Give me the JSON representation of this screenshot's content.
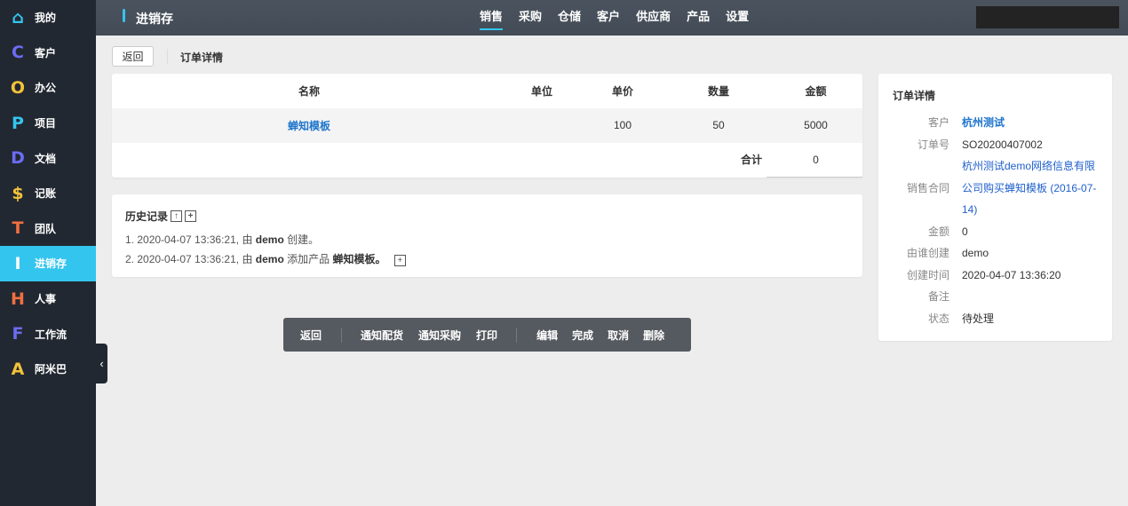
{
  "sidebar": {
    "items": [
      {
        "label": "我的",
        "icon": "home-icon",
        "glyph": "⌂",
        "color": "#33c5ee"
      },
      {
        "label": "客户",
        "icon": "letter-c-icon",
        "glyph": "C",
        "color": "#6c6cf2"
      },
      {
        "label": "办公",
        "icon": "letter-o-icon",
        "glyph": "O",
        "color": "#f2c23a"
      },
      {
        "label": "项目",
        "icon": "letter-p-icon",
        "glyph": "P",
        "color": "#33c5ee"
      },
      {
        "label": "文档",
        "icon": "letter-d-icon",
        "glyph": "D",
        "color": "#6c6cf2"
      },
      {
        "label": "记账",
        "icon": "dollar-icon",
        "glyph": "$",
        "color": "#f2c23a"
      },
      {
        "label": "团队",
        "icon": "letter-t-icon",
        "glyph": "T",
        "color": "#f07040"
      },
      {
        "label": "进销存",
        "icon": "letter-i-icon",
        "glyph": "I",
        "color": "#ffffff"
      },
      {
        "label": "人事",
        "icon": "letter-h-icon",
        "glyph": "H",
        "color": "#f07040"
      },
      {
        "label": "工作流",
        "icon": "letter-f-icon",
        "glyph": "F",
        "color": "#6c6cf2"
      },
      {
        "label": "阿米巴",
        "icon": "letter-a-icon",
        "glyph": "A",
        "color": "#f2c23a"
      }
    ],
    "active": 7
  },
  "header": {
    "app_title": "进销存",
    "nav": [
      "销售",
      "采购",
      "仓储",
      "客户",
      "供应商",
      "产品",
      "设置"
    ],
    "active_nav": 0,
    "search_placeholder": ""
  },
  "page": {
    "back_label": "返回",
    "title": "订单详情"
  },
  "table": {
    "columns": [
      "名称",
      "单位",
      "单价",
      "数量",
      "金额"
    ],
    "rows": [
      {
        "name": "蝉知模板",
        "unit": "",
        "price": "100",
        "qty": "50",
        "amount": "5000"
      }
    ],
    "total_label": "合计",
    "total_value": "0"
  },
  "history": {
    "title": "历史记录",
    "entries": [
      {
        "prefix": "1. 2020-04-07 13:36:21, 由 ",
        "user": "demo",
        "action": " 创建。",
        "object": ""
      },
      {
        "prefix": "2. 2020-04-07 13:36:21, 由 ",
        "user": "demo",
        "action": " 添加产品 ",
        "object": "蝉知模板。"
      }
    ]
  },
  "toolbar": {
    "back": "返回",
    "notify_delivery": "通知配货",
    "notify_purchase": "通知采购",
    "print": "打印",
    "edit": "编辑",
    "finish": "完成",
    "cancel": "取消",
    "delete": "删除"
  },
  "info": {
    "title": "订单详情",
    "fields": [
      {
        "label": "客户",
        "value": "杭州测试"
      },
      {
        "label": "订单号",
        "value": "SO20200407002"
      },
      {
        "label": "销售合同",
        "value": "杭州测试demo网络信息有限公司购买蝉知模板 (2016-07-14)"
      },
      {
        "label": "金额",
        "value": "0"
      },
      {
        "label": "由谁创建",
        "value": "demo"
      },
      {
        "label": "创建时间",
        "value": "2020-04-07 13:36:20"
      },
      {
        "label": "备注",
        "value": ""
      },
      {
        "label": "状态",
        "value": "待处理"
      }
    ]
  }
}
